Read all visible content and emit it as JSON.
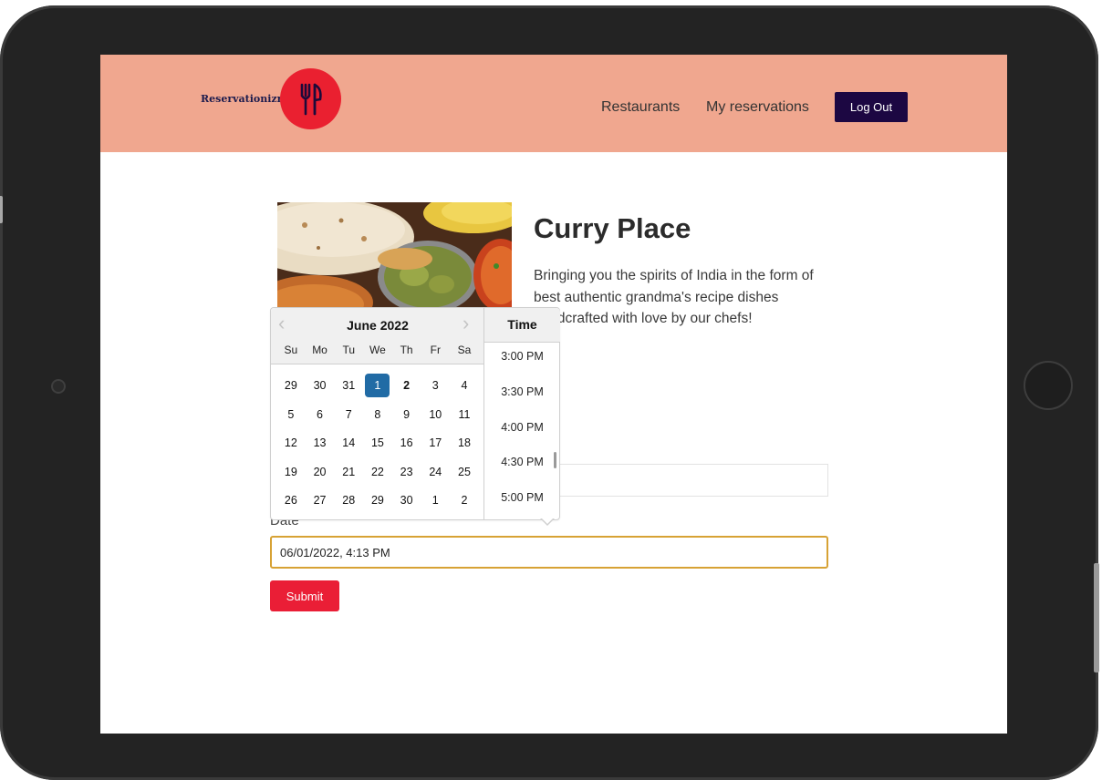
{
  "header": {
    "brand": "Reservationizr",
    "logo_icon": "fork-knife-icon",
    "nav": [
      "Restaurants",
      "My reservations"
    ],
    "logout_label": "Log Out",
    "bg_color": "#f0a78f",
    "logo_color": "#ea2030"
  },
  "restaurant": {
    "name": "Curry Place",
    "description": "Bringing you the spirits of India in the form of best authentic grandma's recipe dishes handcrafted with love by our chefs!"
  },
  "form": {
    "date_label": "Date",
    "date_value": "06/01/2022, 4:13 PM",
    "submit_label": "Submit",
    "submit_color": "#ea1e36"
  },
  "datepicker": {
    "month_label": "June 2022",
    "weekdays": [
      "Su",
      "Mo",
      "Tu",
      "We",
      "Th",
      "Fr",
      "Sa"
    ],
    "weeks": [
      [
        "29",
        "30",
        "31",
        "1",
        "2",
        "3",
        "4"
      ],
      [
        "5",
        "6",
        "7",
        "8",
        "9",
        "10",
        "11"
      ],
      [
        "12",
        "13",
        "14",
        "15",
        "16",
        "17",
        "18"
      ],
      [
        "19",
        "20",
        "21",
        "22",
        "23",
        "24",
        "25"
      ],
      [
        "26",
        "27",
        "28",
        "29",
        "30",
        "1",
        "2"
      ]
    ],
    "selected_day": "1",
    "today": "2",
    "selected_color": "#216ba5",
    "time_header": "Time",
    "times": [
      "3:00 PM",
      "3:30 PM",
      "4:00 PM",
      "4:30 PM",
      "5:00 PM"
    ]
  }
}
